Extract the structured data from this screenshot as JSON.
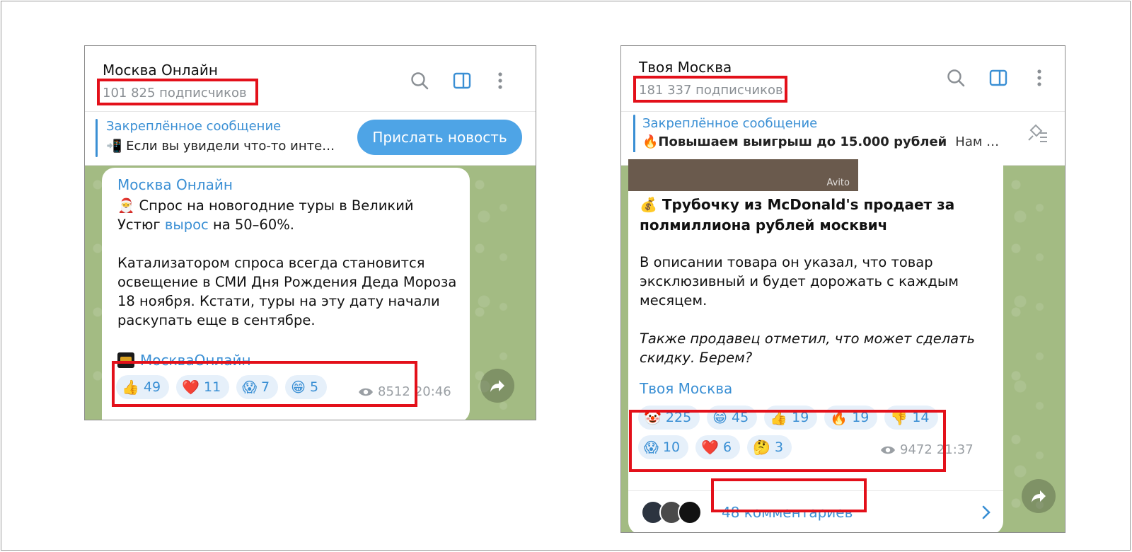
{
  "colors": {
    "accent": "#3a8fd4",
    "highlight": "#e3101a",
    "chat_bg": "#a3bb83"
  },
  "left": {
    "channel_title": "Москва Онлайн",
    "subscribers": "101 825 подписчиков",
    "pinned_title": "Закреплённое сообщение",
    "pinned_text": "📲 Если вы увидели что-то инте…",
    "send_news_label": "Прислать новость",
    "post": {
      "sender": "Москва Онлайн",
      "line1_prefix": "🎅 Спрос на новогодние туры в Великий Устюг ",
      "line1_link": "вырос",
      "line1_suffix": " на 50–60%.",
      "paragraph2": "Катализатором спроса всегда становится освещение в СМИ Дня Рождения Деда Мороза 18 ноября. Кстати, туры на эту дату начали раскупать еще в сентябре.",
      "signature": "МоскваОнлайн",
      "reactions": [
        {
          "emoji": "👍",
          "count": "49"
        },
        {
          "emoji": "❤️",
          "count": "11"
        },
        {
          "emoji": "😱",
          "count": "7"
        },
        {
          "emoji": "😁",
          "count": "5"
        }
      ],
      "views": "8512",
      "time": "20:46"
    }
  },
  "right": {
    "channel_title": "Твоя Москва",
    "subscribers": "181 337 подписчиков",
    "pinned_title": "Закреплённое сообщение",
    "pinned_text": "🔥Повышаем выигрыш до 15.000 рублей",
    "pinned_tail": "Нам …",
    "post": {
      "photo_watermark": "Avito",
      "headline": "💰 Трубочку из McDonald's продает за полмиллиона рублей москвич",
      "paragraph1": "В описании товара он указал, что товар эксклюзивный и будет дорожать с каждым месяцем.",
      "paragraph2": "Также продавец отметил, что может сделать скидку. Берем?",
      "signature": "Твоя Москва",
      "reactions": [
        {
          "emoji": "🤡",
          "count": "225"
        },
        {
          "emoji": "😁",
          "count": "45"
        },
        {
          "emoji": "👍",
          "count": "19"
        },
        {
          "emoji": "🔥",
          "count": "19"
        },
        {
          "emoji": "👎",
          "count": "14"
        },
        {
          "emoji": "😱",
          "count": "10"
        },
        {
          "emoji": "❤️",
          "count": "6"
        },
        {
          "emoji": "🤔",
          "count": "3"
        }
      ],
      "views": "9472",
      "time": "21:37",
      "comments": "48 комментариев"
    }
  },
  "icons": [
    "search-icon",
    "sidebar-toggle-icon",
    "more-vertical-icon",
    "pin-list-icon",
    "forward-icon",
    "eye-icon",
    "chevron-right-icon"
  ]
}
